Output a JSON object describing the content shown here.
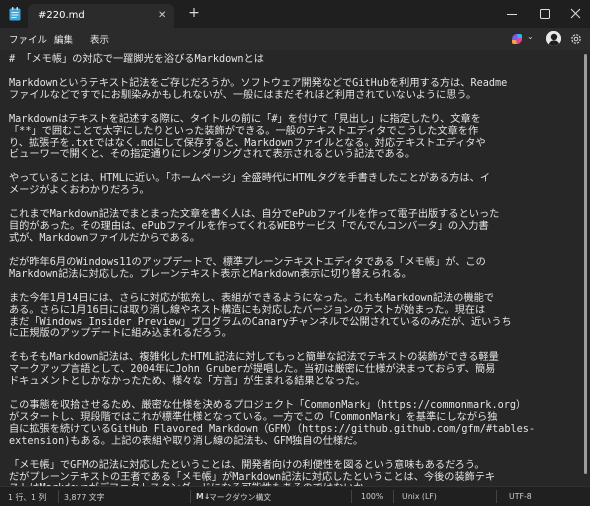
{
  "window": {
    "tab_title": "#220.md",
    "new_tab_symbol": "+",
    "tab_close_symbol": "✕",
    "icons": [
      "notepad-app-icon",
      "minimize-icon",
      "maximize-icon",
      "close-icon"
    ]
  },
  "menu": {
    "file": "ファイル",
    "edit": "編集",
    "view": "表示",
    "icons": [
      "copilot-icon",
      "chevron-down-icon",
      "user-avatar",
      "gear-icon"
    ]
  },
  "editor": {
    "paragraphs": [
      [
        "# 「メモ帳」の対応で一躍脚光を浴びるMarkdownとは"
      ],
      [
        "Markdownというテキスト記法をご存じだろうか。ソフトウェア開発などでGitHubを利用する方は、Readme",
        "ファイルなどですでにお馴染みかもしれないが、一般にはまだそれほど利用されていないように思う。"
      ],
      [
        "Markdownはテキストを記述する際に、タイトルの前に「#」を付けて「見出し」に指定したり、文章を",
        "「**」で囲むことで太字にしたりといった装飾ができる。一般のテキストエディタでこうした文章を作",
        "り、拡張子を.txtではなく.mdにして保存すると、Markdownファイルとなる。対応テキストエディタや",
        "ビューワーで開くと、その指定通りにレンダリングされて表示されるという記法である。"
      ],
      [
        "やっていることは、HTMLに近い。「ホームページ」全盛時代にHTMLタグを手書きしたことがある方は、イ",
        "メージがよくおわかりだろう。"
      ],
      [
        "これまでMarkdown記法でまとまった文章を書く人は、自分でePubファイルを作って電子出版するといった",
        "目的があった。その理由は、ePubファイルを作ってくれるWEBサービス「でんでんコンバータ」の入力書",
        "式が、Markdownファイルだからである。"
      ],
      [
        "だが昨年6月のWindows11のアップデートで、標準プレーンテキストエディタである「メモ帳」が、この",
        "Markdown記法に対応した。プレーンテキスト表示とMarkdown表示に切り替えられる。"
      ],
      [
        "また今年1月14日には、さらに対応が拡充し、表組ができるようになった。これもMarkdown記法の機能で",
        "ある。さらに1月16日には取り消し線やネスト構造にも対応したバージョンのテストが始まった。現在は",
        "まだ「Windows Insider Preview」プログラムのCanaryチャンネルで公開されているのみだが、近いうち",
        "に正規版のアップデートに組み込まれるだろう。"
      ],
      [
        "そもそもMarkdown記法は、複雑化したHTML記法に対してもっと簡単な記法でテキストの装飾ができる軽量",
        "マークアップ言語として、2004年にJohn Gruberが提唱した。当初は厳密に仕様が決まっておらず、簡易",
        "ドキュメントとしかなかったため、様々な「方言」が生まれる結果となった。"
      ],
      [
        "この事態を収拾させるため、厳密な仕様を決めるプロジェクト「CommonMark」（https://commonmark.org）",
        "がスタートし、現段階ではこれが標準仕様となっている。一方でこの「CommonMark」を基準にしながら独",
        "自に拡張を続けているGitHub Flavored Markdown（GFM）（https://github.github.com/gfm/#tables-",
        "extension)もある。上記の表組や取り消し線の記法も、GFM独自の仕様だ。"
      ],
      [
        "「メモ帳」でGFMの記法に対応したということは、開発者向けの利便性を図るという意味もあるだろう。",
        "だがプレーンテキストの王者である「メモ帳」がMarkdown記法に対応したということは、今後の装飾テキ",
        "ストはMarkdownがデファクトスタンダードになる可能性もあるのではないか。"
      ],
      [
        "## ■誰にでも渡せる文章フォーマット"
      ]
    ]
  },
  "status": {
    "position": "1 行、1 列",
    "chars": "3,877 文字",
    "mode_icon": "markdown-icon",
    "mode_icon_text": "M↓",
    "mode": "マークダウン構文",
    "zoom": "100%",
    "eol": "Unix (LF)",
    "encoding": "UTF-8"
  }
}
